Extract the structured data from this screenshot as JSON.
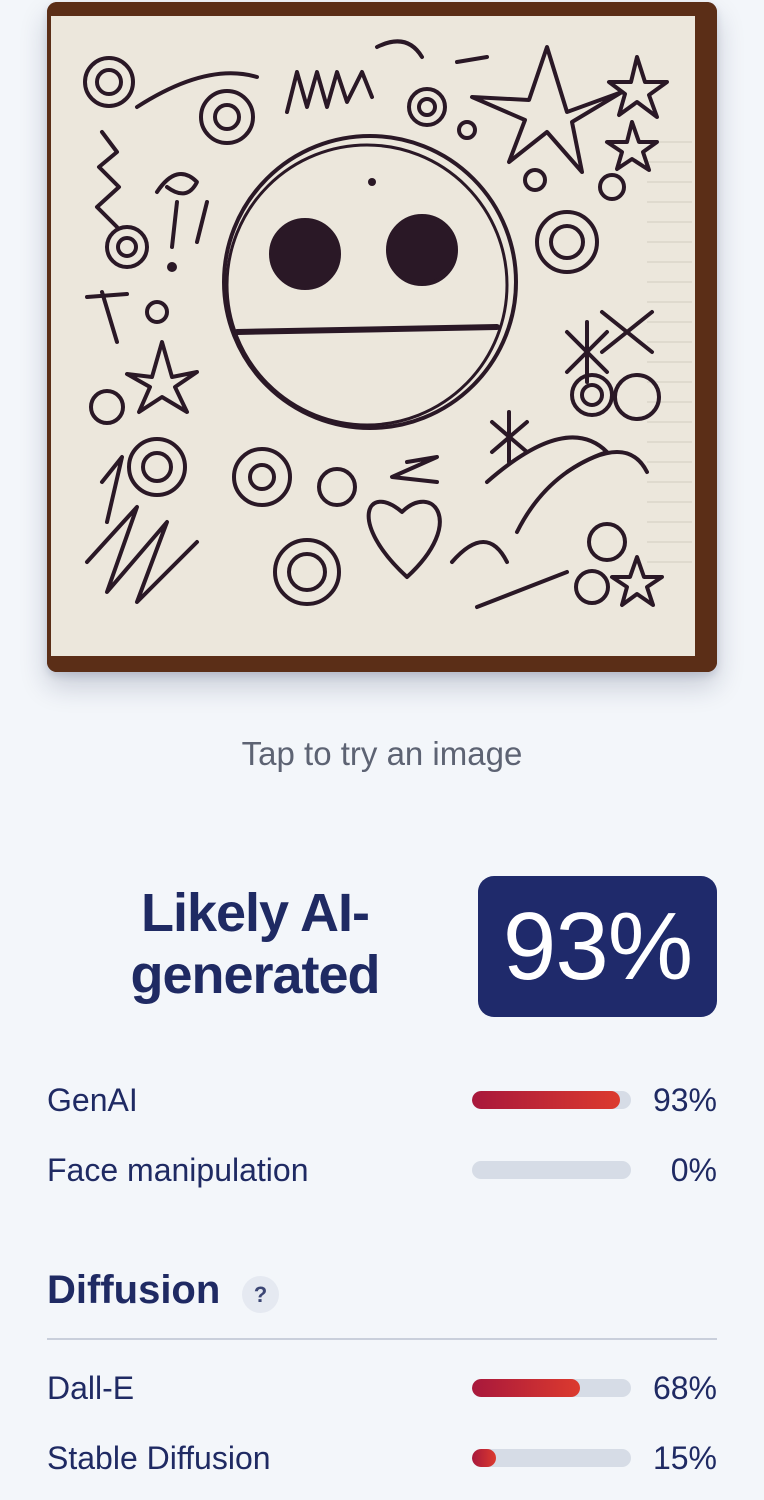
{
  "preview": {
    "hint": "Tap to try an image"
  },
  "result": {
    "verdict": "Likely AI-generated",
    "score": "93%"
  },
  "metrics": [
    {
      "label": "GenAI",
      "value": 0.93,
      "pct_text": "93%"
    },
    {
      "label": "Face manipulation",
      "value": 0.0,
      "pct_text": "0%"
    }
  ],
  "diffusion": {
    "title": "Diffusion",
    "help": "?",
    "items": [
      {
        "label": "Dall-E",
        "value": 0.68,
        "pct_text": "68%"
      },
      {
        "label": "Stable Diffusion",
        "value": 0.15,
        "pct_text": "15%"
      }
    ]
  },
  "colors": {
    "accent": "#1f2a6b",
    "bar_start": "#a8183c",
    "bar_end": "#dc3a2e",
    "track": "#d6dce6"
  }
}
